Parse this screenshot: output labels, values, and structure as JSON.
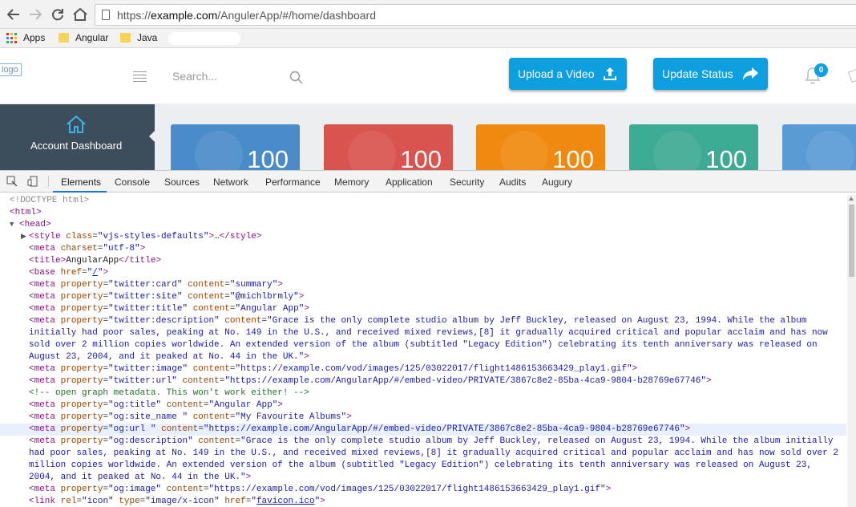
{
  "browser": {
    "url_prefix": "https://",
    "url_host": "example.com",
    "url_path": "/AngulerApp/#/home/dashboard",
    "bookmarks": [
      "Apps",
      "Angular",
      "Java"
    ]
  },
  "header": {
    "logo_text": "logo",
    "search_placeholder": "Search...",
    "upload_label": "Upload a Video",
    "update_label": "Update Status",
    "notification_count": "0"
  },
  "sidebar": {
    "active_label": "Account Dashboard"
  },
  "tiles": [
    {
      "value": "100",
      "color": "#4a8cc9"
    },
    {
      "value": "100",
      "color": "#d9534f"
    },
    {
      "value": "100",
      "color": "#f0890f"
    },
    {
      "value": "100",
      "color": "#3daa93"
    },
    {
      "value": "",
      "color": "#5b9bd5"
    }
  ],
  "devtools": {
    "tabs": [
      "Elements",
      "Console",
      "Sources",
      "Network",
      "Performance",
      "Memory",
      "Application",
      "Security",
      "Audits",
      "Augury"
    ],
    "active_tab": "Elements",
    "lines": [
      "<!DOCTYPE html>",
      "<html>",
      "<head>",
      "<style class=\"vjs-styles-defaults\">…</style>",
      "<meta charset=\"utf-8\">",
      "<title>AngularApp</title>",
      "<base href=\"/\">",
      "<meta property=\"twitter:card\" content=\"summary\">",
      "<meta property=\"twitter:site\" content=\"@michlbrmly\">",
      "<meta property=\"twitter:title\" content=\"Angular App\">",
      "<meta property=\"twitter:description\" content=\"Grace is the only complete studio album by Jeff Buckley, released on August 23, 1994. While the album initially had poor sales, peaking at No. 149 in the U.S., and received mixed reviews,[8] it gradually acquired critical and popular acclaim and has now sold over 2 million copies worldwide. An extended version of the album (subtitled \"Legacy Edition\") celebrating its tenth anniversary was released on August 23, 2004, and it peaked at No. 44 in the UK.\">",
      "<meta property=\"twitter:image\" content=\"https://example.com/vod/images/125/03022017/flight1486153663429_play1.gif\">",
      "<meta property=\"twitter:url\" content=\"https://example.com/AngularApp/#/embed-video/PRIVATE/3867c8e2-85ba-4ca9-9804-b28769e67746\">",
      "<!-- open graph metadata. This won't work either! -->",
      "<meta property=\"og:title\" content=\"Angular App\">",
      "<meta property=\"og:site_name \" content=\"My Favourite Albums\">",
      "<meta property=\"og:url \" content=\"https://example.com/AngularApp/#/embed-video/PRIVATE/3867c8e2-85ba-4ca9-9804-b28769e67746\">",
      "<meta property=\"og:description\" content=\"Grace is the only complete studio album by Jeff Buckley, released on August 23, 1994. While the album initially had poor sales, peaking at No. 149 in the U.S., and received mixed reviews,[8] it gradually acquired critical and popular acclaim and has now sold over 2 million copies worldwide. An extended version of the album (subtitled \"Legacy Edition\") celebrating its tenth anniversary was released on August 23, 2004, and it peaked at No. 44 in the UK.\">",
      "<meta property=\"og:image\" content=\"https://example.com/vod/images/125/03022017/flight1486153663429_play1.gif\">",
      "<link rel=\"icon\" type=\"image/x-icon\" href=\"favicon.ico\">"
    ]
  }
}
